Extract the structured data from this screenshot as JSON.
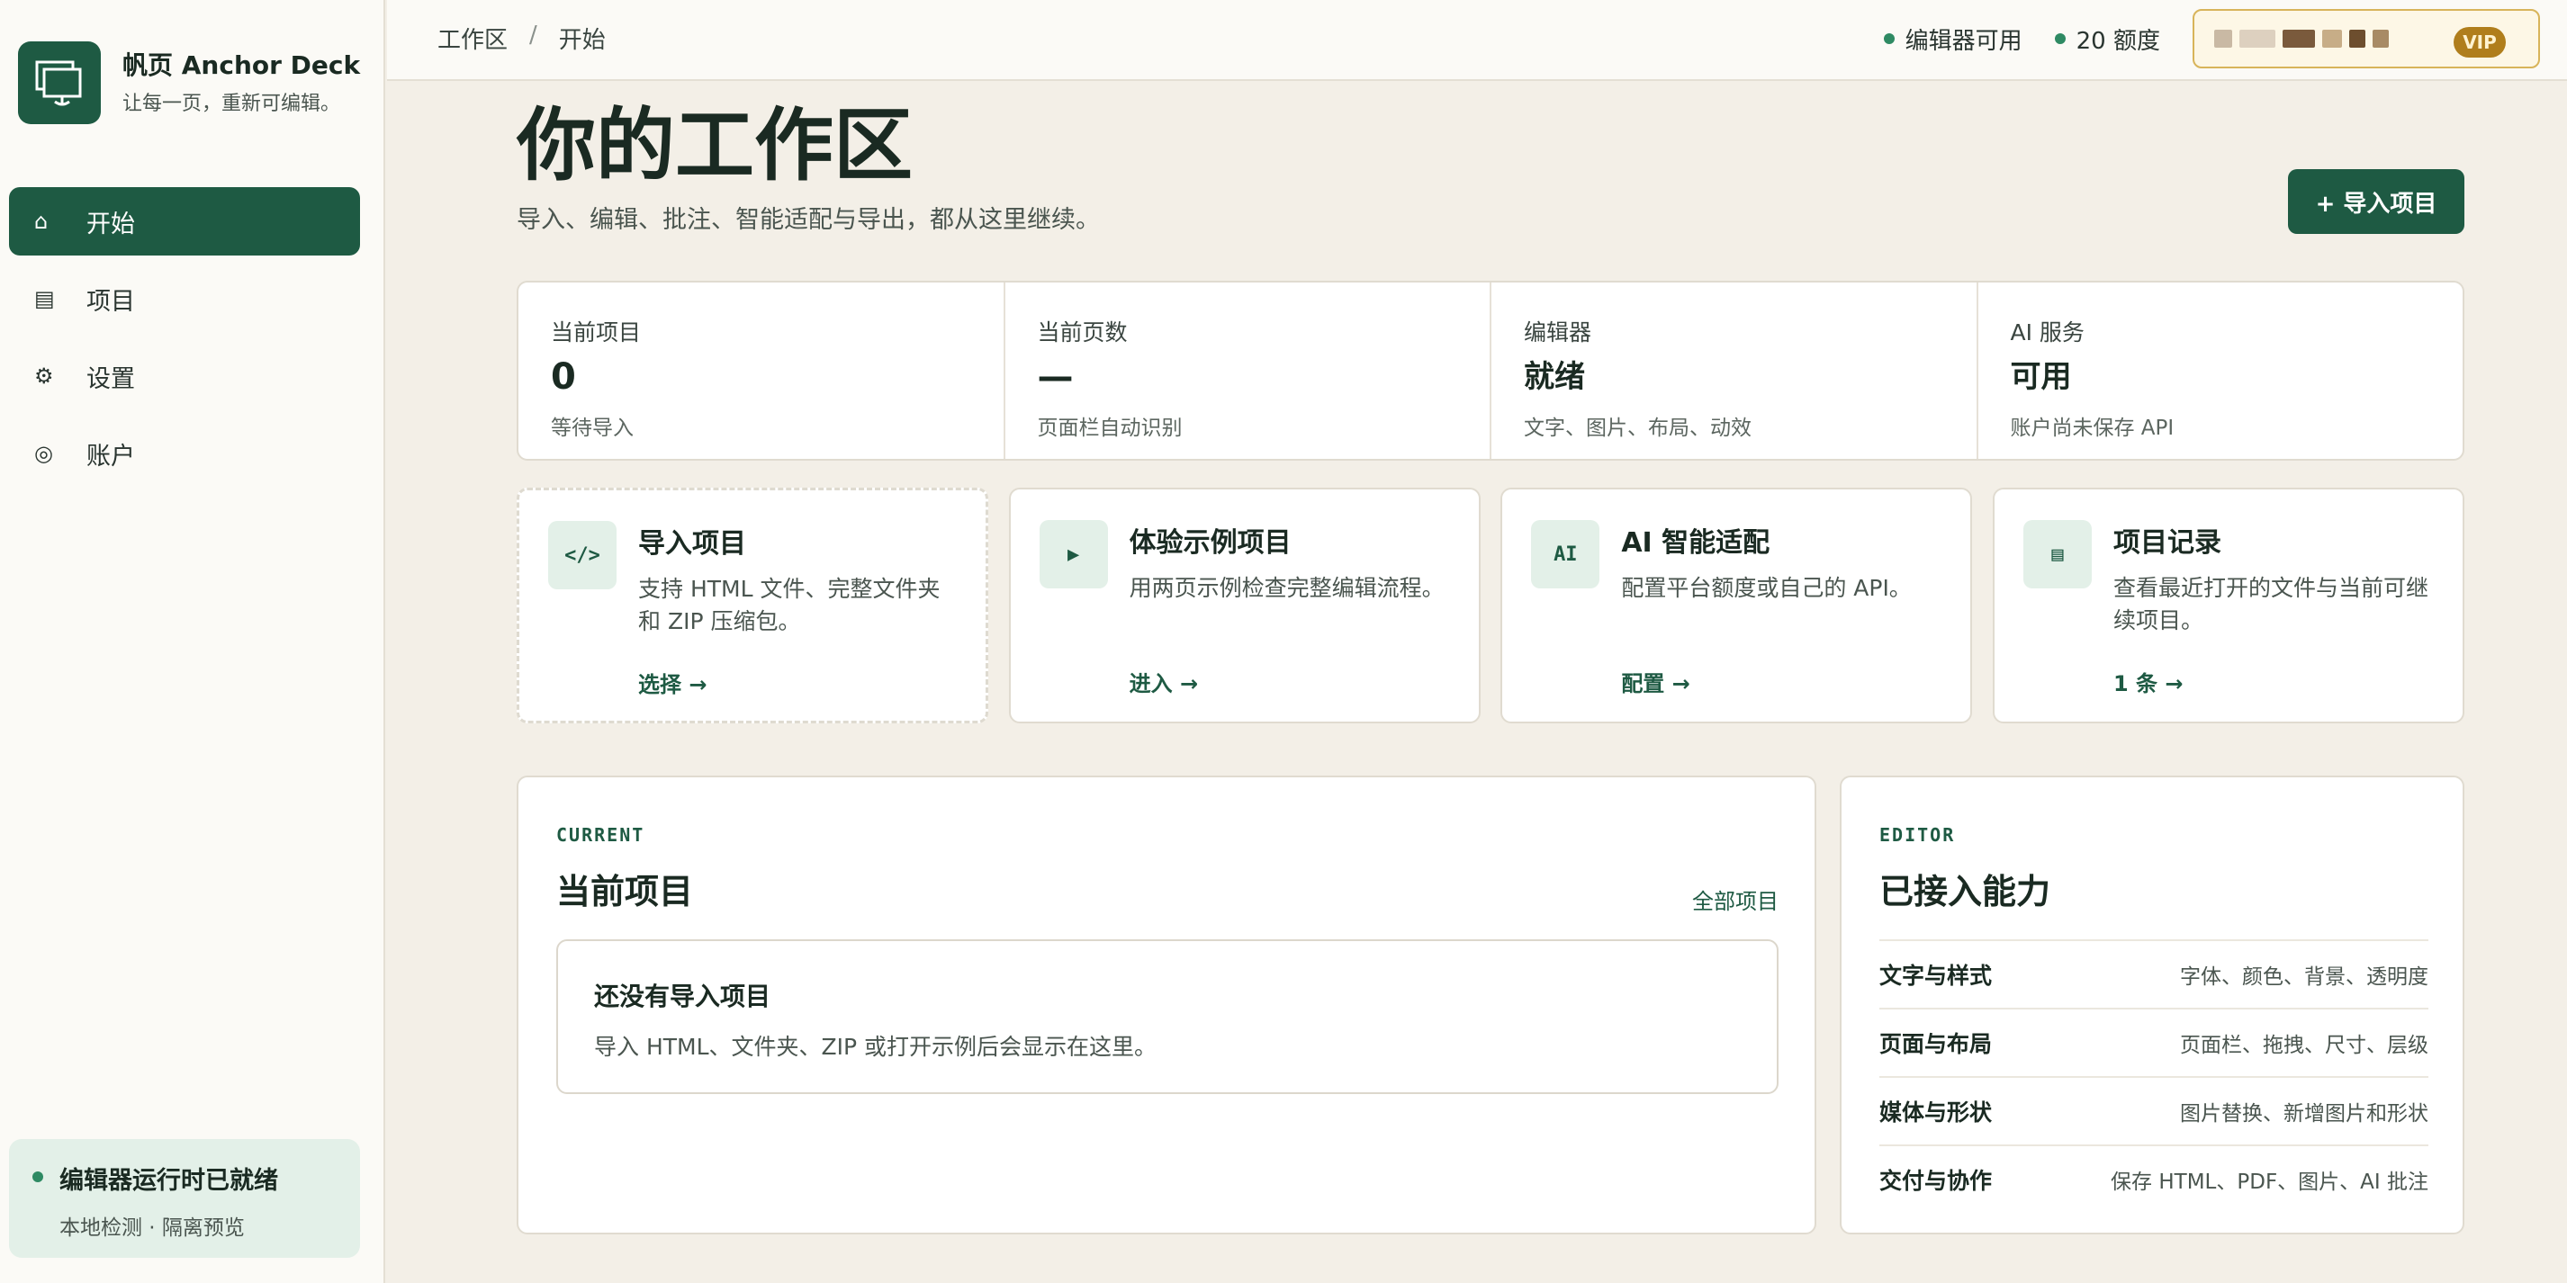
{
  "brand": {
    "name": "帆页 Anchor Deck",
    "tagline": "让每一页，重新可编辑。",
    "icon": "monitor-anchor-icon"
  },
  "sidebar": {
    "items": [
      {
        "icon": "⌂",
        "label": "开始",
        "active": true
      },
      {
        "icon": "▤",
        "label": "项目",
        "active": false
      },
      {
        "icon": "⚙",
        "label": "设置",
        "active": false
      },
      {
        "icon": "◎",
        "label": "账户",
        "active": false
      }
    ],
    "status": {
      "title": "编辑器运行时已就绪",
      "sub": "本地检测 · 隔离预览"
    }
  },
  "topbar": {
    "breadcrumb": [
      "工作区",
      "开始"
    ],
    "breadcrumb_sep": "/",
    "editor_status": "编辑器可用",
    "credits": "20 额度",
    "vip": "VIP"
  },
  "header": {
    "title": "你的工作区",
    "subtitle": "导入、编辑、批注、智能适配与导出，都从这里继续。",
    "import_button": "+ 导入项目"
  },
  "stats": [
    {
      "label": "当前项目",
      "value": "0",
      "note": "等待导入"
    },
    {
      "label": "当前页数",
      "value": "—",
      "note": "页面栏自动识别"
    },
    {
      "label": "编辑器",
      "value": "就绪",
      "note": "文字、图片、布局、动效"
    },
    {
      "label": "AI 服务",
      "value": "可用",
      "note": "账户尚未保存 API"
    }
  ],
  "actions": [
    {
      "icon": "</>",
      "title": "导入项目",
      "desc": "支持 HTML 文件、完整文件夹和 ZIP 压缩包。",
      "link": "选择 →"
    },
    {
      "icon": "▶",
      "title": "体验示例项目",
      "desc": "用两页示例检查完整编辑流程。",
      "link": "进入 →"
    },
    {
      "icon": "AI",
      "title": "AI 智能适配",
      "desc": "配置平台额度或自己的 API。",
      "link": "配置 →"
    },
    {
      "icon": "▤",
      "title": "项目记录",
      "desc": "查看最近打开的文件与当前可继续项目。",
      "link": "1 条 →"
    }
  ],
  "current": {
    "eyebrow": "CURRENT",
    "title": "当前项目",
    "link": "全部项目",
    "empty_title": "还没有导入项目",
    "empty_sub": "导入 HTML、文件夹、ZIP 或打开示例后会显示在这里。"
  },
  "editor": {
    "eyebrow": "EDITOR",
    "title": "已接入能力",
    "capabilities": [
      {
        "name": "文字与样式",
        "desc": "字体、颜色、背景、透明度"
      },
      {
        "name": "页面与布局",
        "desc": "页面栏、拖拽、尺寸、层级"
      },
      {
        "name": "媒体与形状",
        "desc": "图片替换、新增图片和形状"
      },
      {
        "name": "交付与协作",
        "desc": "保存 HTML、PDF、图片、AI 批注"
      }
    ]
  },
  "colors": {
    "accent": "#1e5a43",
    "background": "#f3efe7",
    "status_dot": "#2e8a63",
    "vip_gold": "#b07e1c"
  }
}
